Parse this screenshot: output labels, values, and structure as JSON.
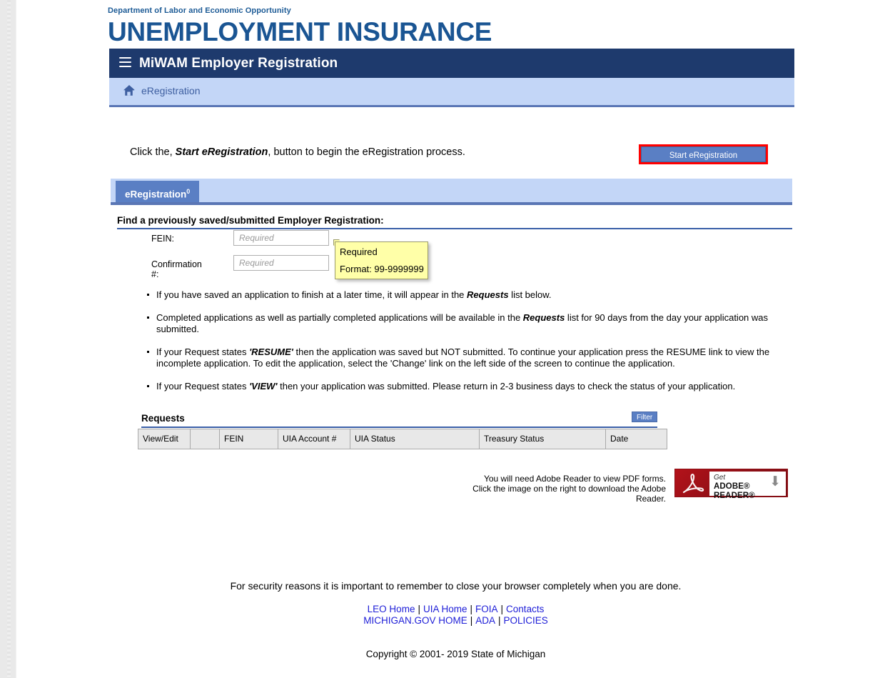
{
  "masthead": {
    "department": "Department of Labor and Economic Opportunity",
    "title": "UNEMPLOYMENT INSURANCE"
  },
  "appbar": {
    "menu_icon": "hamburger-icon",
    "title": "MiWAM Employer Registration"
  },
  "breadcrumb": {
    "home_icon": "home-icon",
    "label": "eRegistration"
  },
  "intro": {
    "prefix": "Click the, ",
    "emphasis": "Start eRegistration",
    "suffix": ", button to begin the eRegistration process.",
    "start_button": "Start eRegistration",
    "highlight_color": "#ff0000",
    "button_color": "#5a7fc4"
  },
  "tabs": [
    {
      "label": "eRegistration",
      "badge": "0",
      "active": true
    }
  ],
  "find_section": {
    "heading": "Find a previously saved/submitted Employer Registration:",
    "fields": [
      {
        "label": "FEIN:",
        "value": "",
        "placeholder": "Required",
        "required": true
      },
      {
        "label": "Confirmation #:",
        "value": "",
        "placeholder": "Required",
        "required": true
      }
    ],
    "tooltip": {
      "line1": "Required",
      "line2": "Format: 99-9999999"
    }
  },
  "bullets": [
    {
      "parts": [
        {
          "t": "If you have saved an application to finish at a later time, it will appear in the "
        },
        {
          "t": "Requests",
          "b": true
        },
        {
          "t": " list below."
        }
      ]
    },
    {
      "parts": [
        {
          "t": "Completed applications as well as partially completed applications will be available in the "
        },
        {
          "t": "Requests",
          "b": true
        },
        {
          "t": " list for 90 days from the day your application was submitted."
        }
      ]
    },
    {
      "parts": [
        {
          "t": "If your Request states "
        },
        {
          "t": "'RESUME'",
          "b": true
        },
        {
          "t": " then the application was saved but NOT submitted. To continue your application press the RESUME link to view the incomplete application. To edit the application, select the 'Change' link on the left side of the screen to continue the application."
        }
      ]
    },
    {
      "parts": [
        {
          "t": "If your Request states "
        },
        {
          "t": "'VIEW'",
          "b": true
        },
        {
          "t": " then your application was submitted. Please return in 2-3 business days to check the status of your application."
        }
      ]
    }
  ],
  "requests": {
    "title": "Requests",
    "filter_label": "Filter",
    "columns": [
      "View/Edit",
      "",
      "FEIN",
      "UIA Account #",
      "UIA Status",
      "Treasury Status",
      "Date"
    ],
    "rows": []
  },
  "adobe": {
    "line1": "You will need Adobe Reader to view PDF forms.",
    "line2": "Click the image on the right to download the Adobe Reader.",
    "badge_get": "Get",
    "badge_name": "ADOBE® READER®",
    "badge_color": "#b3121a"
  },
  "footer": {
    "security_note": "For security reasons it is important to remember to close your browser completely when you are done.",
    "links_row1": [
      "LEO Home",
      "UIA Home",
      "FOIA",
      "Contacts"
    ],
    "links_row2": [
      "MICHIGAN.GOV HOME",
      "ADA",
      "POLICIES"
    ],
    "copyright": "Copyright © 2001- 2019 State of Michigan"
  }
}
